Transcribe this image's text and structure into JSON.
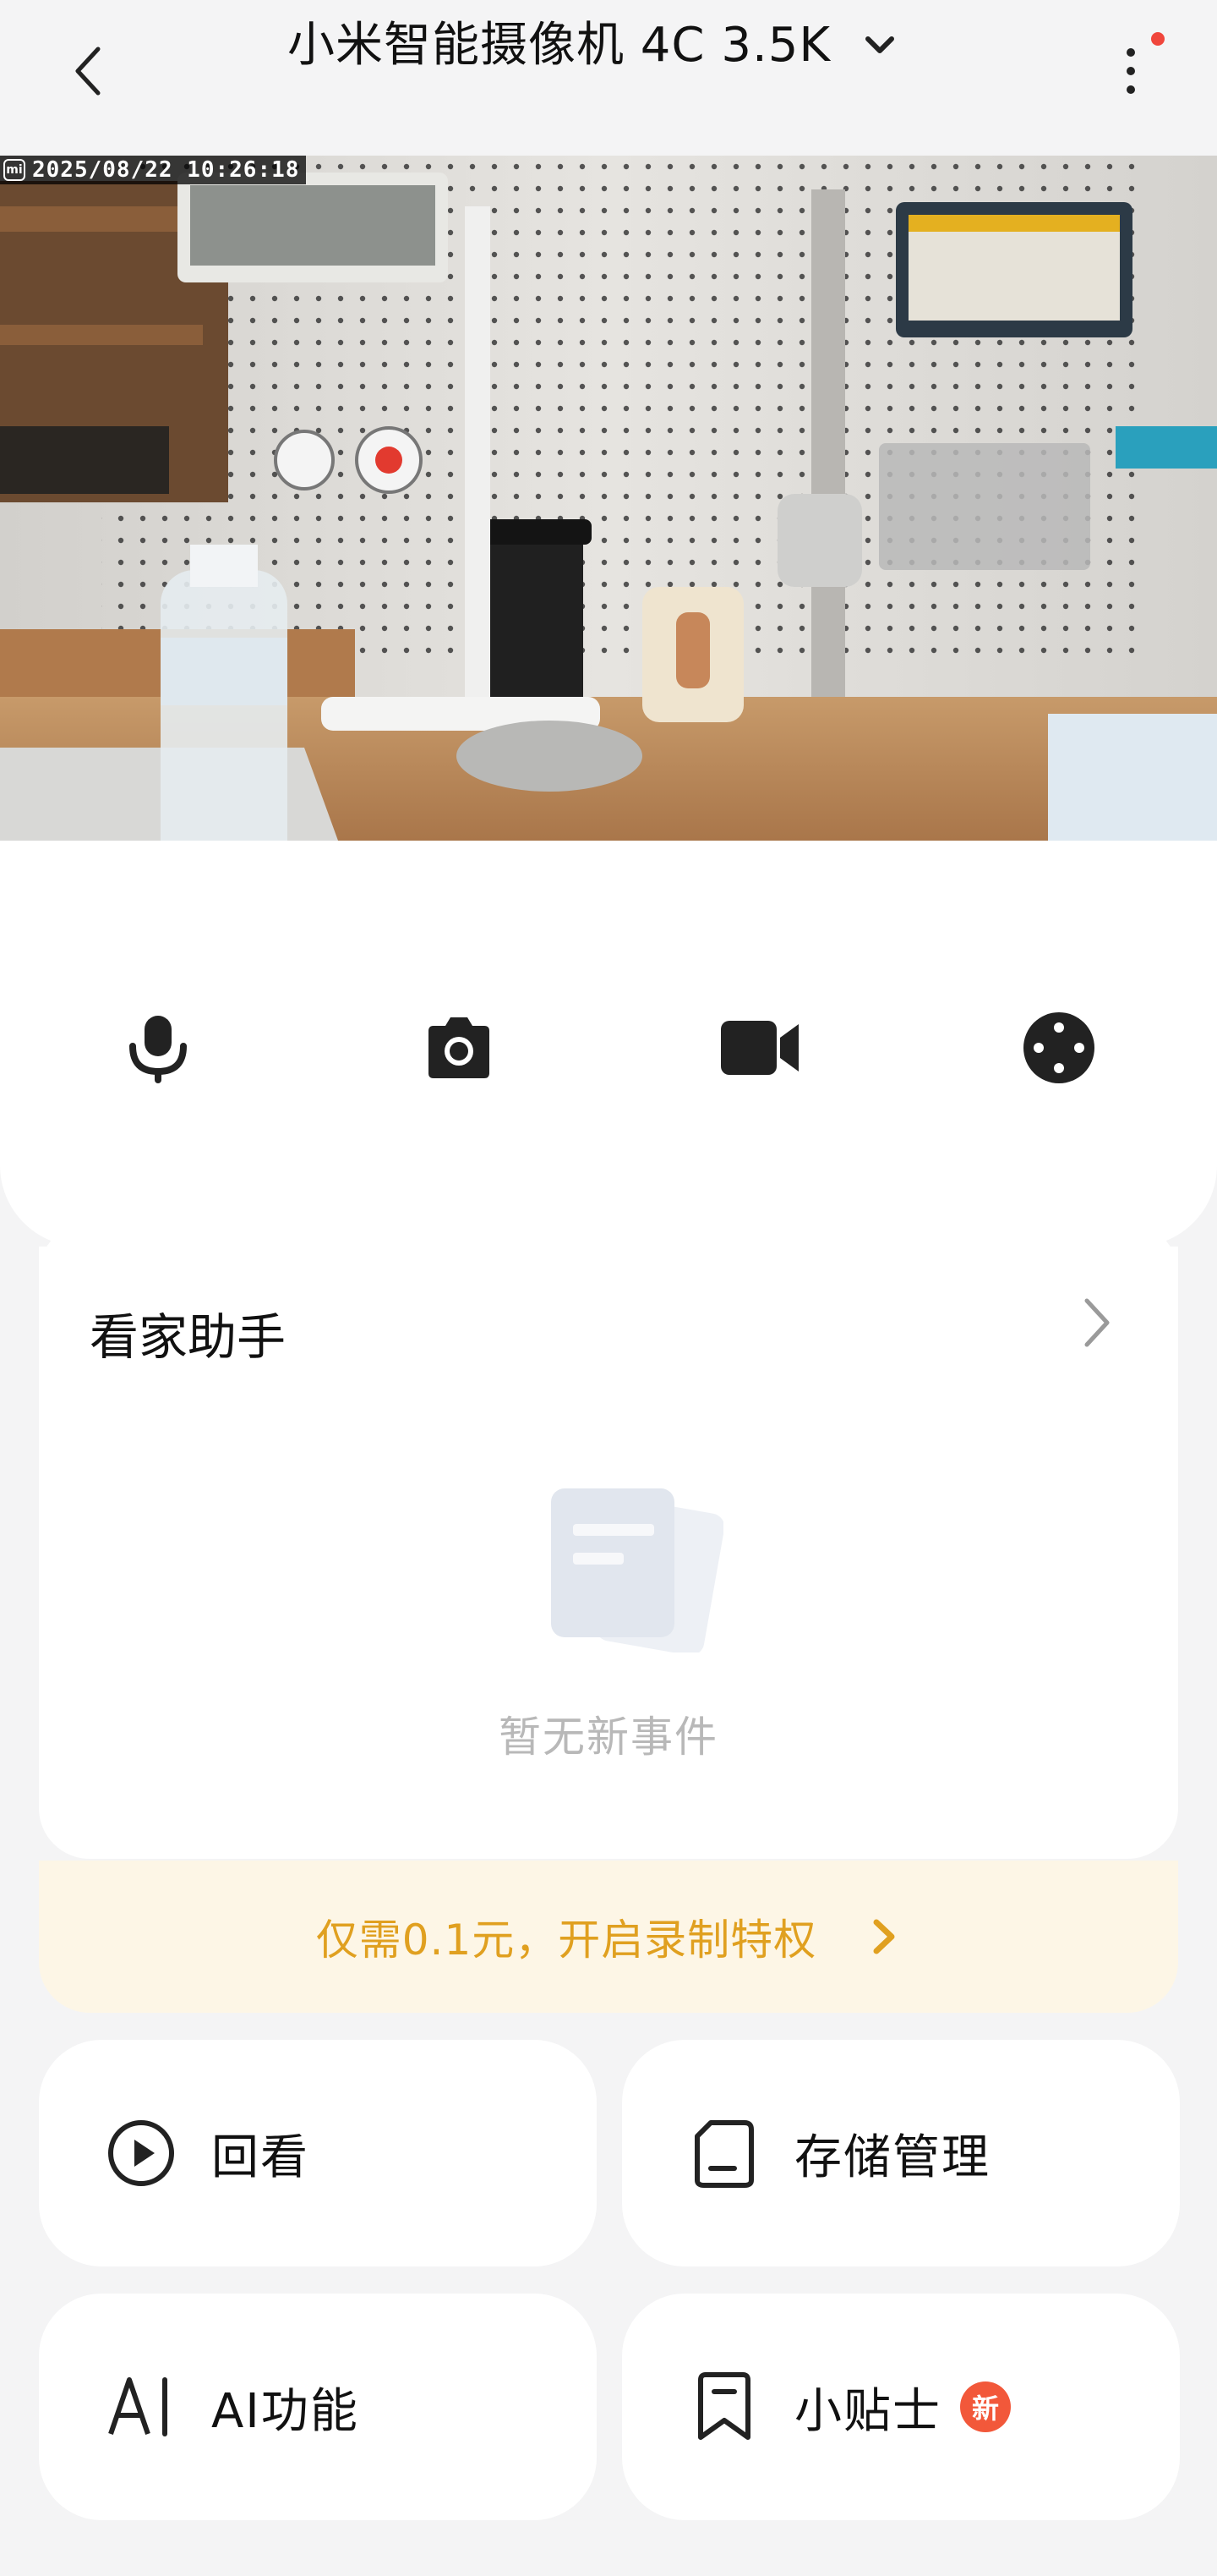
{
  "header": {
    "title": "小米智能摄像机 4C 3.5K",
    "back_icon": "chevron-left-icon",
    "dropdown_icon": "chevron-down-icon",
    "more_icon": "more-vertical-icon",
    "notification_dot_color": "#f0463c"
  },
  "preview": {
    "timestamp": "2025/08/22 10:26:18",
    "brand_mark": "mi"
  },
  "controls": [
    {
      "name": "microphone",
      "icon": "microphone-icon"
    },
    {
      "name": "screenshot",
      "icon": "camera-icon"
    },
    {
      "name": "record",
      "icon": "video-camera-icon"
    },
    {
      "name": "pan-tilt",
      "icon": "direction-pad-icon"
    }
  ],
  "assistant": {
    "title": "看家助手",
    "empty_text": "暂无新事件",
    "promo_text": "仅需0.1元，开启录制特权",
    "promo_color": "#e0a020"
  },
  "tiles": [
    {
      "label": "回看",
      "icon": "play-circle-icon"
    },
    {
      "label": "存储管理",
      "icon": "storage-icon"
    },
    {
      "label": "AI功能",
      "icon": "ai-icon"
    },
    {
      "label": "小贴士",
      "icon": "bookmark-icon",
      "badge": "新"
    }
  ]
}
